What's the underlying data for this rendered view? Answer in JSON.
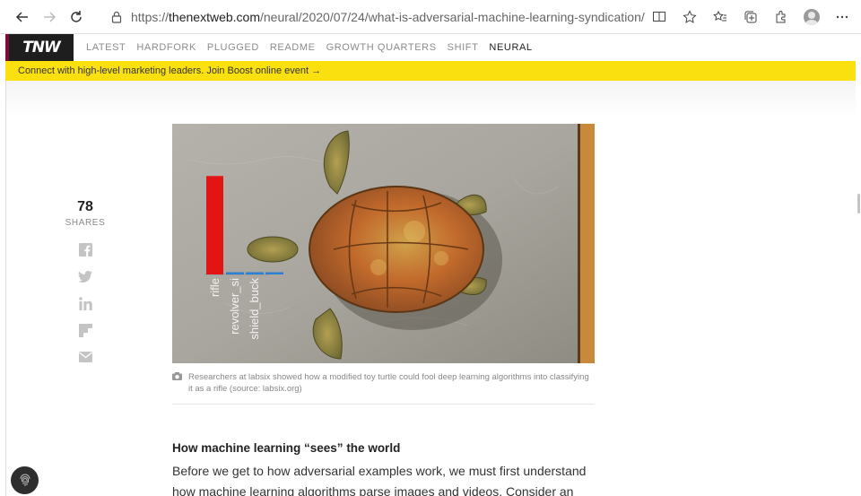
{
  "browser": {
    "url_prefix": "https://",
    "url_host": "thenextweb.com",
    "url_path": "/neural/2020/07/24/what-is-adversarial-machine-learning-syndication/"
  },
  "site": {
    "logo_text": "TNW",
    "nav": [
      "LATEST",
      "HARDFORK",
      "PLUGGED",
      "README",
      "GROWTH QUARTERS",
      "SHIFT",
      "NEURAL"
    ],
    "active_nav": "NEURAL",
    "promo_text": "Connect with high-level marketing leaders. Join Boost online event →"
  },
  "share": {
    "count": "78",
    "label": "SHARES",
    "networks": [
      "facebook-icon",
      "twitter-icon",
      "linkedin-icon",
      "flipboard-icon",
      "email-icon"
    ]
  },
  "figure": {
    "chart_data": {
      "type": "bar",
      "categories": [
        "rifle",
        "revolver",
        "shield",
        "buckle"
      ],
      "category_labels": [
        "rifle",
        "revolver_si",
        "shield_buck",
        ""
      ],
      "values": [
        0.98,
        0.02,
        0.015,
        0.01
      ],
      "colors": [
        "#e31414",
        "#2d7fd1",
        "#2d7fd1",
        "#2d7fd1"
      ]
    },
    "caption": "Researchers at labsix showed how a modified toy turtle could fool deep learning algorithms into classifying it as a rifle (source: labsix.org)"
  },
  "article": {
    "section_title": "How machine learning “sees” the world",
    "body": "Before we get to how adversarial examples work, we must first understand how machine learning algorithms parse images and videos. Consider an"
  }
}
